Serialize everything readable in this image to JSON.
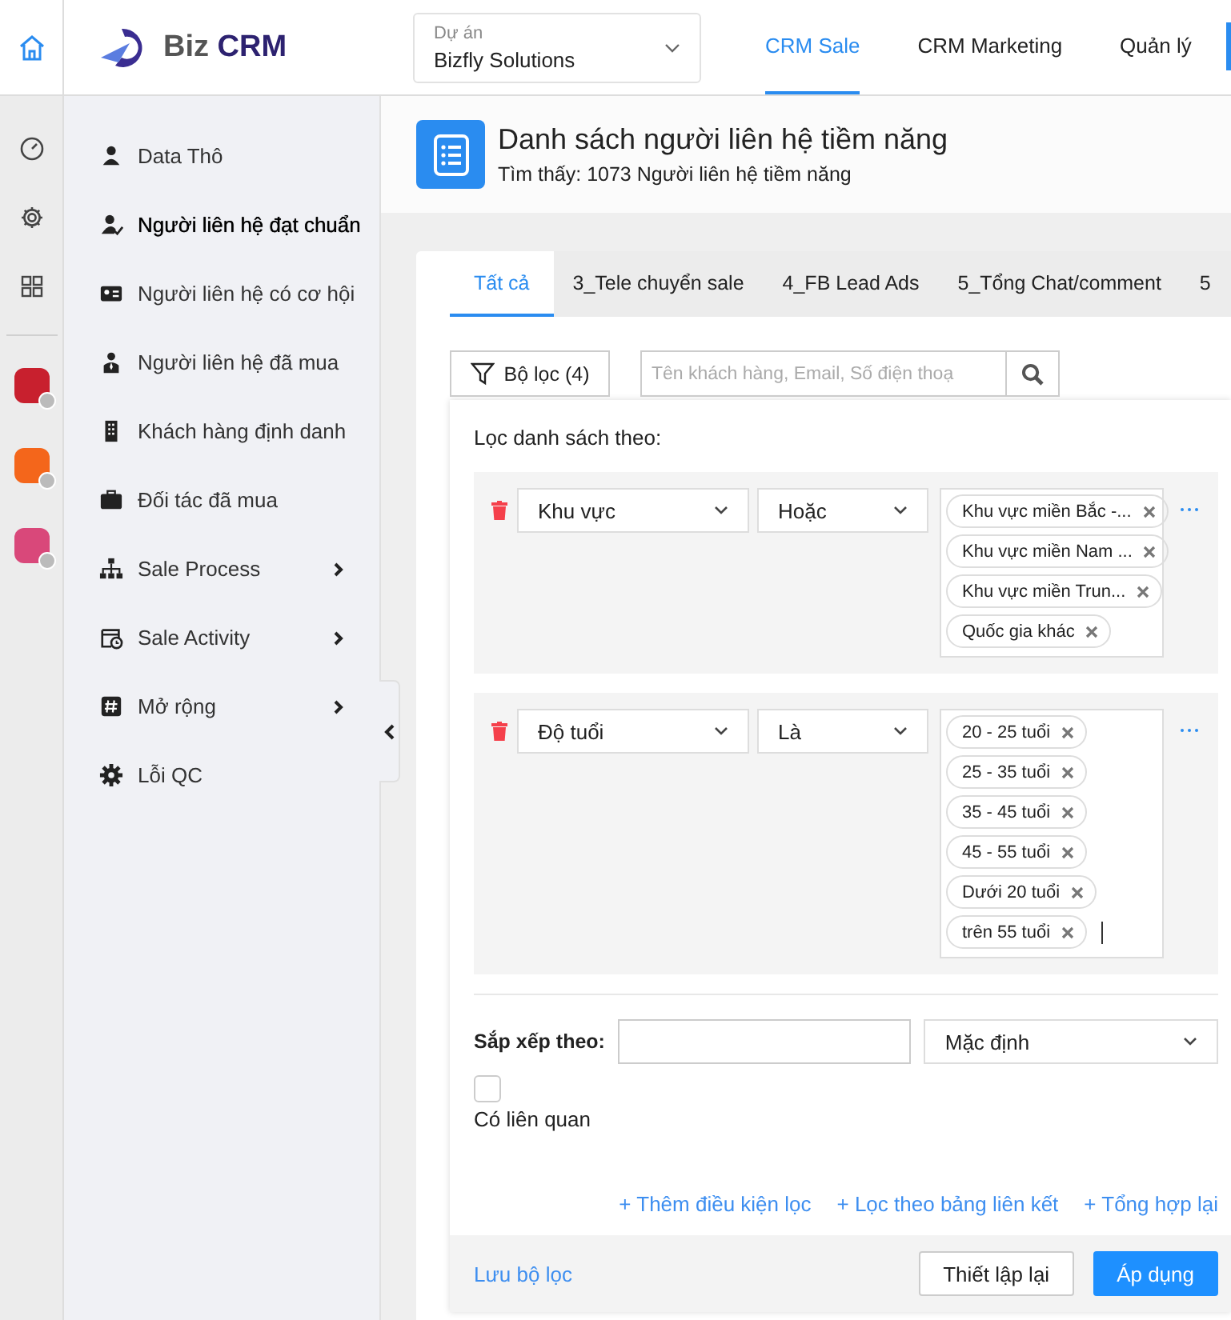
{
  "logo": {
    "text_1": "Biz",
    "text_2": "CRM"
  },
  "project_select": {
    "label": "Dự án",
    "value": "Bizfly Solutions"
  },
  "nav": [
    {
      "label": "CRM Sale",
      "selected": true
    },
    {
      "label": "CRM Marketing",
      "selected": false
    },
    {
      "label": "Quản lý",
      "selected": false
    }
  ],
  "rail": {
    "apps": [
      {
        "color": "#c8202e"
      },
      {
        "color": "#f4661b"
      },
      {
        "color": "#d9487a"
      }
    ]
  },
  "sidebar": {
    "items": [
      {
        "label": "Data Thô",
        "has_submenu": false,
        "selected": false
      },
      {
        "label": "Người liên hệ đạt chuẩn",
        "has_submenu": false,
        "selected": true
      },
      {
        "label": "Người liên hệ có cơ hội",
        "has_submenu": false,
        "selected": false
      },
      {
        "label": "Người liên hệ đã mua",
        "has_submenu": false,
        "selected": false
      },
      {
        "label": "Khách hàng định danh",
        "has_submenu": false,
        "selected": false
      },
      {
        "label": "Đối tác đã mua",
        "has_submenu": false,
        "selected": false
      },
      {
        "label": "Sale Process",
        "has_submenu": true,
        "selected": false
      },
      {
        "label": "Sale Activity",
        "has_submenu": true,
        "selected": false
      },
      {
        "label": "Mở rộng",
        "has_submenu": true,
        "selected": false
      },
      {
        "label": "Lỗi QC",
        "has_submenu": false,
        "selected": false
      }
    ]
  },
  "page_header": {
    "title": "Danh sách người liên hệ tiềm năng",
    "subtitle": "Tìm thấy: 1073 Người liên hệ tiềm năng"
  },
  "tabs": [
    {
      "label": "Tất cả",
      "selected": true
    },
    {
      "label": "3_Tele chuyển sale",
      "selected": false
    },
    {
      "label": "4_FB Lead Ads",
      "selected": false
    },
    {
      "label": "5_Tổng Chat/comment",
      "selected": false
    },
    {
      "label": "5",
      "selected": false
    }
  ],
  "filter_button": {
    "label": "Bộ lọc (4)"
  },
  "search": {
    "placeholder": "Tên khách hàng, Email, Số điện thoạ"
  },
  "filter_panel": {
    "title": "Lọc danh sách theo:",
    "conditions": [
      {
        "field": "Khu vực",
        "operator": "Hoặc",
        "cursor": false,
        "tags": [
          "Khu vực miền Bắc -...",
          "Khu vực miền Nam ...",
          "Khu vực miền Trun...",
          "Quốc gia khác"
        ]
      },
      {
        "field": "Độ tuổi",
        "operator": "Là",
        "cursor": true,
        "tags": [
          "20 - 25 tuổi",
          "25 - 35 tuổi",
          "35 - 45 tuổi",
          "45 - 55 tuổi",
          "Dưới 20 tuổi",
          "trên 55 tuổi"
        ]
      }
    ],
    "sort": {
      "label": "Sắp xếp theo:",
      "value": "Mặc định"
    },
    "related": {
      "label": "Có liên quan",
      "checked": false
    },
    "links": [
      "+ Thêm điều kiện lọc",
      "+ Lọc theo bảng liên kết",
      "+ Tổng hợp lại"
    ],
    "save_link": "Lưu bộ lọc",
    "buttons": [
      {
        "label": "Thiết lập lại",
        "kind": "secondary"
      },
      {
        "label": "Áp dụng",
        "kind": "primary"
      }
    ]
  }
}
